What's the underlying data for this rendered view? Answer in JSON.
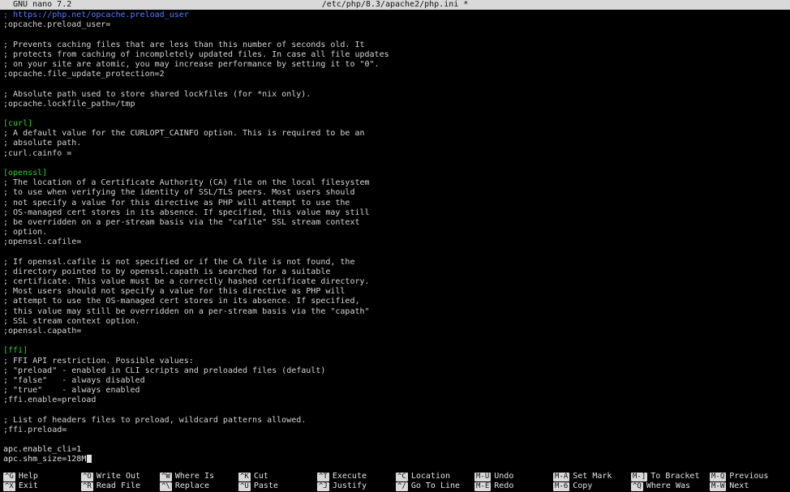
{
  "titlebar": {
    "app": "GNU nano 7.2",
    "file": "/etc/php/8.3/apache2/php.ini *"
  },
  "editor": {
    "lines": [
      {
        "type": "url",
        "text": "; https://php.net/opcache.preload_user"
      },
      {
        "type": "comment",
        "text": ";opcache.preload_user="
      },
      {
        "type": "blank",
        "text": ""
      },
      {
        "type": "comment",
        "text": "; Prevents caching files that are less than this number of seconds old. It"
      },
      {
        "type": "comment",
        "text": "; protects from caching of incompletely updated files. In case all file updates"
      },
      {
        "type": "comment",
        "text": "; on your site are atomic, you may increase performance by setting it to \"0\"."
      },
      {
        "type": "comment",
        "text": ";opcache.file_update_protection=2"
      },
      {
        "type": "blank",
        "text": ""
      },
      {
        "type": "comment",
        "text": "; Absolute path used to store shared lockfiles (for *nix only)."
      },
      {
        "type": "comment",
        "text": ";opcache.lockfile_path=/tmp"
      },
      {
        "type": "blank",
        "text": ""
      },
      {
        "type": "section",
        "text": "[curl]"
      },
      {
        "type": "comment",
        "text": "; A default value for the CURLOPT_CAINFO option. This is required to be an"
      },
      {
        "type": "comment",
        "text": "; absolute path."
      },
      {
        "type": "comment",
        "text": ";curl.cainfo ="
      },
      {
        "type": "blank",
        "text": ""
      },
      {
        "type": "section",
        "text": "[openssl]"
      },
      {
        "type": "comment",
        "text": "; The location of a Certificate Authority (CA) file on the local filesystem"
      },
      {
        "type": "comment",
        "text": "; to use when verifying the identity of SSL/TLS peers. Most users should"
      },
      {
        "type": "comment",
        "text": "; not specify a value for this directive as PHP will attempt to use the"
      },
      {
        "type": "comment",
        "text": "; OS-managed cert stores in its absence. If specified, this value may still"
      },
      {
        "type": "comment",
        "text": "; be overridden on a per-stream basis via the \"cafile\" SSL stream context"
      },
      {
        "type": "comment",
        "text": "; option."
      },
      {
        "type": "comment",
        "text": ";openssl.cafile="
      },
      {
        "type": "blank",
        "text": ""
      },
      {
        "type": "comment",
        "text": "; If openssl.cafile is not specified or if the CA file is not found, the"
      },
      {
        "type": "comment",
        "text": "; directory pointed to by openssl.capath is searched for a suitable"
      },
      {
        "type": "comment",
        "text": "; certificate. This value must be a correctly hashed certificate directory."
      },
      {
        "type": "comment",
        "text": "; Most users should not specify a value for this directive as PHP will"
      },
      {
        "type": "comment",
        "text": "; attempt to use the OS-managed cert stores in its absence. If specified,"
      },
      {
        "type": "comment",
        "text": "; this value may still be overridden on a per-stream basis via the \"capath\""
      },
      {
        "type": "comment",
        "text": "; SSL stream context option."
      },
      {
        "type": "comment",
        "text": ";openssl.capath="
      },
      {
        "type": "blank",
        "text": ""
      },
      {
        "type": "section",
        "text": "[ffi]"
      },
      {
        "type": "comment",
        "text": "; FFI API restriction. Possible values:"
      },
      {
        "type": "comment",
        "text": "; \"preload\" - enabled in CLI scripts and preloaded files (default)"
      },
      {
        "type": "comment",
        "text": "; \"false\"   - always disabled"
      },
      {
        "type": "comment",
        "text": "; \"true\"    - always enabled"
      },
      {
        "type": "comment",
        "text": ";ffi.enable=preload"
      },
      {
        "type": "blank",
        "text": ""
      },
      {
        "type": "comment",
        "text": "; List of headers files to preload, wildcard patterns allowed."
      },
      {
        "type": "comment",
        "text": ";ffi.preload="
      },
      {
        "type": "blank",
        "text": ""
      },
      {
        "type": "plain",
        "text": "apc.enable_cli=1"
      },
      {
        "type": "plain",
        "text": "apc.shm_size=128M",
        "cursor": true
      }
    ]
  },
  "shortcuts": [
    {
      "key": "^G",
      "label": "Help"
    },
    {
      "key": "^O",
      "label": "Write Out"
    },
    {
      "key": "^W",
      "label": "Where Is"
    },
    {
      "key": "^K",
      "label": "Cut"
    },
    {
      "key": "^T",
      "label": "Execute"
    },
    {
      "key": "^C",
      "label": "Location"
    },
    {
      "key": "M-U",
      "label": "Undo"
    },
    {
      "key": "M-A",
      "label": "Set Mark"
    },
    {
      "key": "M-]",
      "label": "To Bracket"
    },
    {
      "key": "M-Q",
      "label": "Previous"
    },
    {
      "key": "^X",
      "label": "Exit"
    },
    {
      "key": "^R",
      "label": "Read File"
    },
    {
      "key": "^\\",
      "label": "Replace"
    },
    {
      "key": "^U",
      "label": "Paste"
    },
    {
      "key": "^J",
      "label": "Justify"
    },
    {
      "key": "^/",
      "label": "Go To Line"
    },
    {
      "key": "M-E",
      "label": "Redo"
    },
    {
      "key": "M-6",
      "label": "Copy"
    },
    {
      "key": "^Q",
      "label": "Where Was"
    },
    {
      "key": "M-W",
      "label": "Next"
    }
  ]
}
